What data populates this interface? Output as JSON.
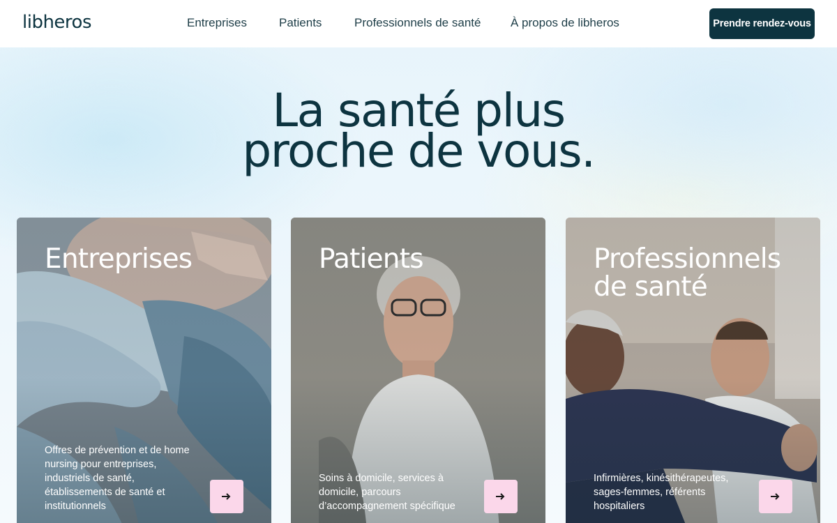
{
  "header": {
    "logo": "libheros",
    "nav": [
      {
        "label": "Entreprises"
      },
      {
        "label": "Patients"
      },
      {
        "label": "Professionnels de santé"
      },
      {
        "label": "À propos de libheros"
      }
    ],
    "cta_label": "Prendre rendez-vous"
  },
  "hero": {
    "title_line1": "La santé plus",
    "title_line2": "proche de vous."
  },
  "cards": [
    {
      "title": "Entreprises",
      "description": "Offres de prévention et de home nursing pour entreprises, industriels de santé, établissements de santé et institutionnels",
      "icon": "arrow-right-icon"
    },
    {
      "title": "Patients",
      "description": "Soins à domicile, services à domicile, parcours d’accompagnement spécifique",
      "icon": "arrow-right-icon"
    },
    {
      "title": "Professionnels de santé",
      "description": "Infirmières, kinésithérapeutes, sages-femmes, référents hospitaliers",
      "icon": "arrow-right-icon"
    }
  ],
  "colors": {
    "brand_dark": "#0d3440",
    "arrow_button_bg": "#fbd7ea",
    "background": "#eaf5fb"
  }
}
